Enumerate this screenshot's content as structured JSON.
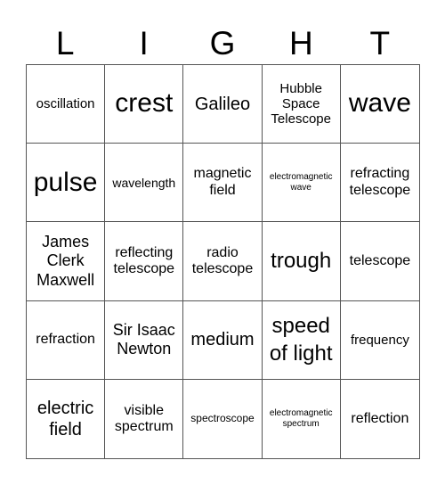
{
  "header": [
    "L",
    "I",
    "G",
    "H",
    "T"
  ],
  "cells": [
    {
      "text": "oscillation",
      "size": "s15"
    },
    {
      "text": "crest",
      "size": "s30"
    },
    {
      "text": "Galileo",
      "size": "s20"
    },
    {
      "text": "Hubble Space Telescope",
      "size": "s15"
    },
    {
      "text": "wave",
      "size": "s30"
    },
    {
      "text": "pulse",
      "size": "s30"
    },
    {
      "text": "wavelength",
      "size": "s14"
    },
    {
      "text": "magnetic field",
      "size": "s16"
    },
    {
      "text": "electromagnetic wave",
      "size": "s10"
    },
    {
      "text": "refracting telescope",
      "size": "s16"
    },
    {
      "text": "James Clerk Maxwell",
      "size": "s18"
    },
    {
      "text": "reflecting telescope",
      "size": "s16"
    },
    {
      "text": "radio telescope",
      "size": "s16"
    },
    {
      "text": "trough",
      "size": "s24"
    },
    {
      "text": "telescope",
      "size": "s16"
    },
    {
      "text": "refraction",
      "size": "s16"
    },
    {
      "text": "Sir Isaac Newton",
      "size": "s18"
    },
    {
      "text": "medium",
      "size": "s20"
    },
    {
      "text": "speed of light",
      "size": "s24"
    },
    {
      "text": "frequency",
      "size": "s15"
    },
    {
      "text": "electric field",
      "size": "s20"
    },
    {
      "text": "visible spectrum",
      "size": "s16"
    },
    {
      "text": "spectroscope",
      "size": "s12"
    },
    {
      "text": "electromagnetic spectrum",
      "size": "s10"
    },
    {
      "text": "reflection",
      "size": "s16"
    }
  ]
}
